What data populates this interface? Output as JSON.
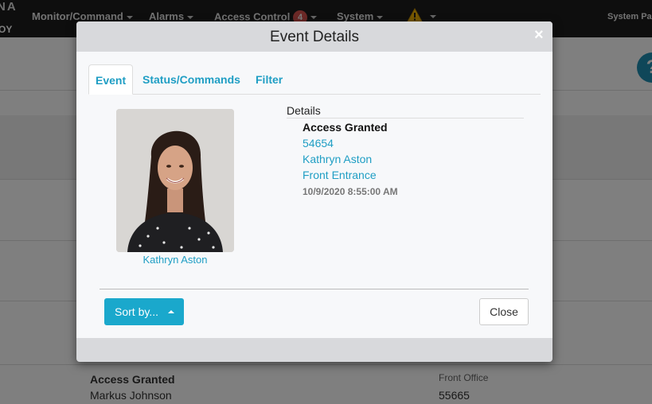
{
  "nav": {
    "logo_top": "NA",
    "logo_bottom": "OY",
    "items": [
      {
        "label": "Monitor/Command"
      },
      {
        "label": "Alarms"
      },
      {
        "label": "Access Control",
        "badge": "4"
      },
      {
        "label": "System"
      }
    ],
    "system_panel": "System Pa"
  },
  "background": {
    "row": {
      "title": "Access Granted",
      "name": "Markus Johnson",
      "location": "Front Office",
      "number": "55665"
    }
  },
  "modal": {
    "title": "Event Details",
    "close_glyph": "×",
    "tabs": [
      {
        "label": "Event",
        "active": true
      },
      {
        "label": "Status/Commands",
        "active": false
      },
      {
        "label": "Filter",
        "active": false
      }
    ],
    "photo_caption": "Kathryn Aston",
    "details": {
      "label": "Details",
      "event_type": "Access Granted",
      "id": "54654",
      "person": "Kathryn Aston",
      "location": "Front Entrance",
      "timestamp": "10/9/2020 8:55:00 AM"
    },
    "sort_label": "Sort by...",
    "close_label": "Close"
  },
  "colors": {
    "accent": "#1aa8cc",
    "link": "#1f9ec4",
    "nav_bg": "#1c1c1c",
    "badge": "#d9534f"
  }
}
